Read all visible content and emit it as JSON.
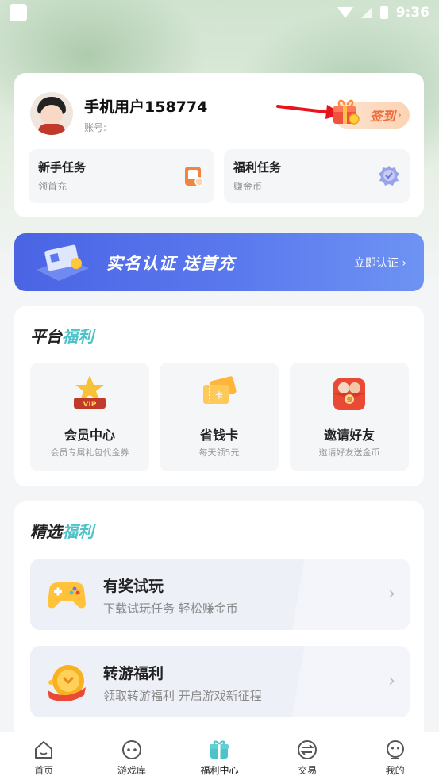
{
  "status_bar": {
    "time": "9:36"
  },
  "user": {
    "name": "手机用户158774",
    "account_label": "账号:",
    "checkin_label": "签到",
    "checkin_chevron": "›"
  },
  "tasks": [
    {
      "title": "新手任务",
      "subtitle": "领首充",
      "icon": "tablet-icon"
    },
    {
      "title": "福利任务",
      "subtitle": "赚金币",
      "icon": "badge-icon"
    }
  ],
  "banner": {
    "title": "实名认证 送首充",
    "cta": "立即认证 ›"
  },
  "platform_welfare": {
    "title_prefix": "平台",
    "title_accent": "福利",
    "items": [
      {
        "title": "会员中心",
        "subtitle": "会员专属礼包代金券",
        "icon": "vip-crown-icon"
      },
      {
        "title": "省钱卡",
        "subtitle": "每天领5元",
        "icon": "card-ticket-icon"
      },
      {
        "title": "邀请好友",
        "subtitle": "邀请好友送金币",
        "icon": "red-envelope-icon"
      }
    ]
  },
  "selected_welfare": {
    "title_prefix": "精选",
    "title_accent": "福利",
    "items": [
      {
        "title": "有奖试玩",
        "subtitle": "下载试玩任务 轻松赚金币",
        "icon": "gamepad-icon"
      },
      {
        "title": "转游福利",
        "subtitle": "领取转游福利 开启游戏新征程",
        "icon": "coin-icon"
      }
    ],
    "chevron": "›"
  },
  "bottom_nav": [
    {
      "label": "首页",
      "icon": "home-icon"
    },
    {
      "label": "游戏库",
      "icon": "game-library-icon"
    },
    {
      "label": "福利中心",
      "icon": "gift-icon",
      "active": true
    },
    {
      "label": "交易",
      "icon": "trade-icon"
    },
    {
      "label": "我的",
      "icon": "profile-icon"
    }
  ],
  "colors": {
    "accent_teal": "#4cc3c9",
    "banner_blue": "#4a64e4",
    "checkin_orange": "#f06a3a"
  }
}
